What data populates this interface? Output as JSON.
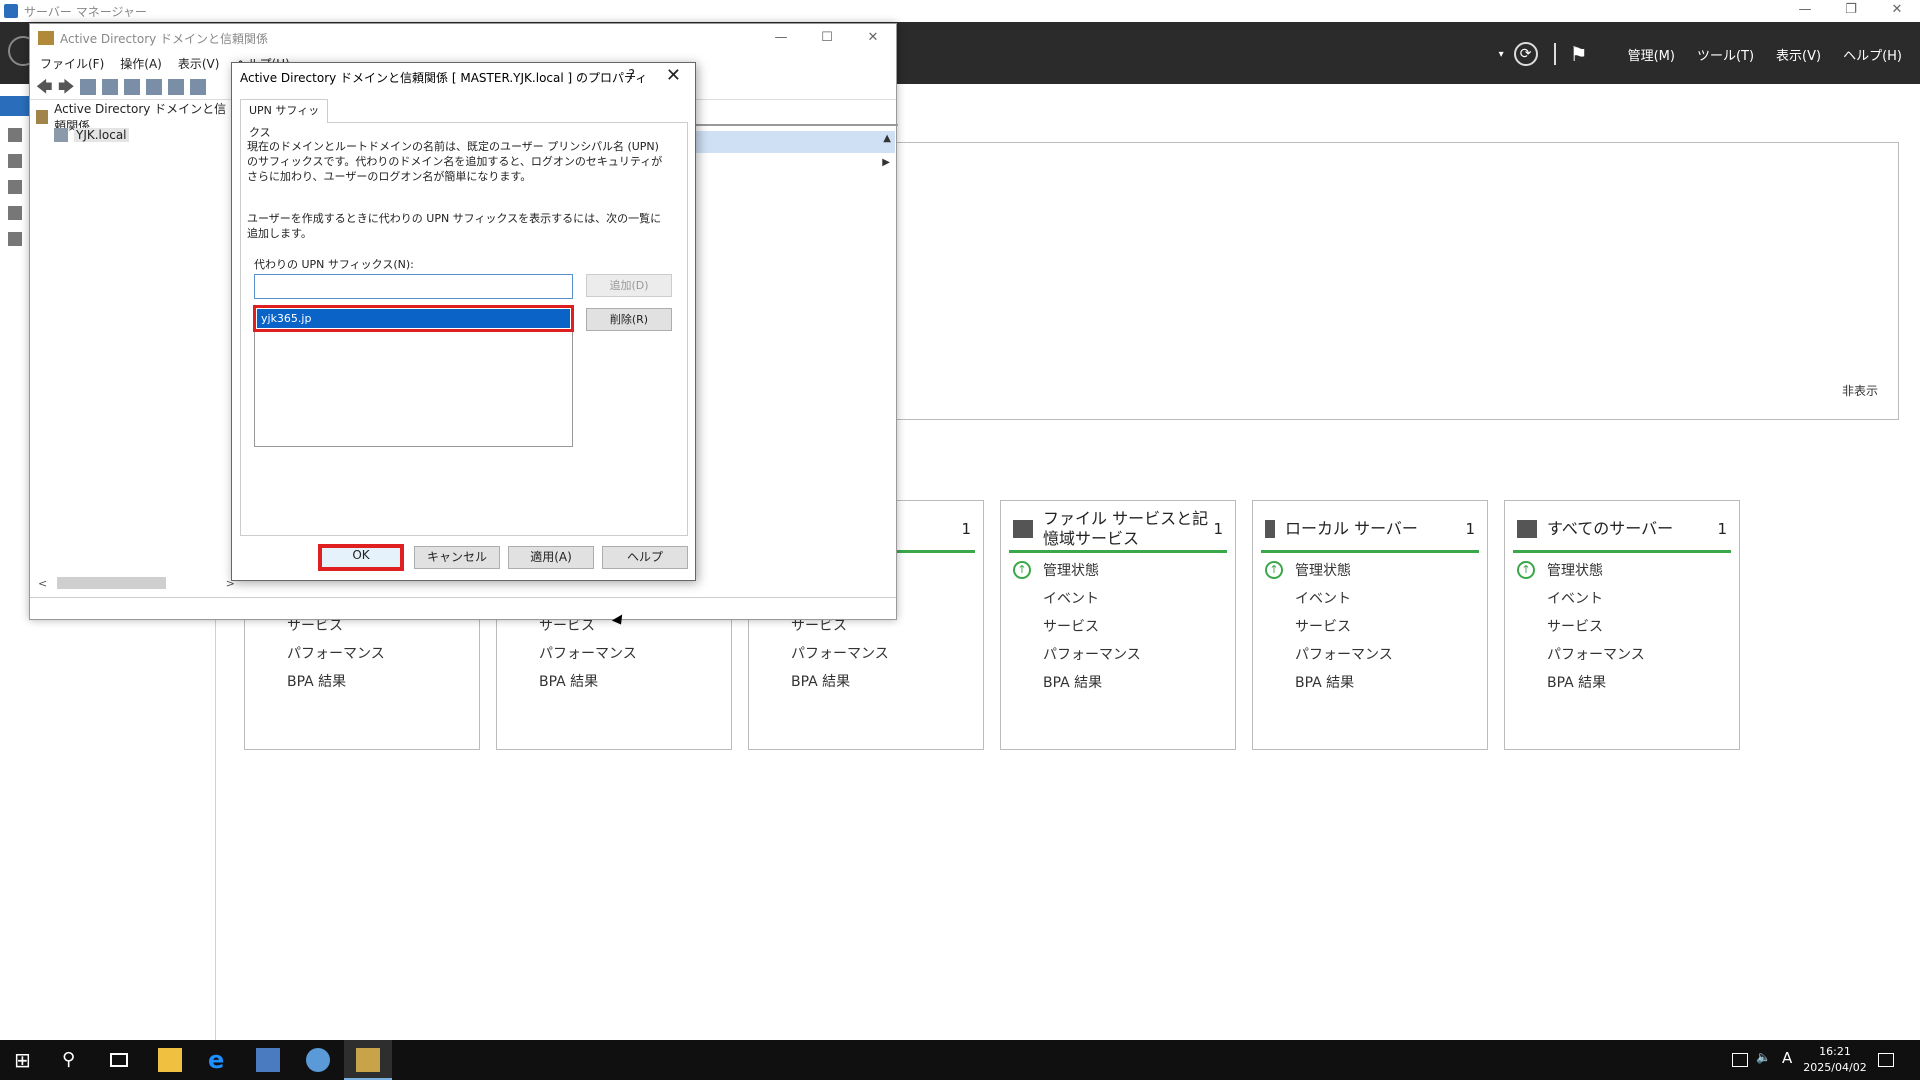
{
  "server_manager": {
    "title": "サーバー マネージャー",
    "win_min": "—",
    "win_restore": "❐",
    "win_close": "✕",
    "menu": {
      "dropdown": "▾",
      "refresh_glyph": "⟳",
      "flag_glyph": "⚑",
      "manage": "管理(M)",
      "tools": "ツール(T)",
      "view": "表示(V)",
      "help": "ヘルプ(H)"
    },
    "welcome": {
      "hide_link": "非表示"
    },
    "tiles": [
      {
        "title": "",
        "count": "",
        "rows": [
          "サービス",
          "パフォーマンス",
          "BPA 結果"
        ]
      },
      {
        "title": "",
        "count": "",
        "rows": [
          "サービス",
          "パフォーマンス",
          "BPA 結果"
        ]
      },
      {
        "title": "",
        "count": "1",
        "rows": [
          "サービス",
          "パフォーマンス",
          "BPA 結果"
        ]
      },
      {
        "title": "ファイル サービスと記憶域サービス",
        "count": "1",
        "rows": [
          "管理状態",
          "イベント",
          "サービス",
          "パフォーマンス",
          "BPA 結果"
        ]
      },
      {
        "title": "ローカル サーバー",
        "count": "1",
        "rows": [
          "管理状態",
          "イベント",
          "サービス",
          "パフォーマンス",
          "BPA 結果"
        ]
      },
      {
        "title": "すべてのサーバー",
        "count": "1",
        "rows": [
          "管理状態",
          "イベント",
          "サービス",
          "パフォーマンス",
          "BPA 結果"
        ]
      }
    ]
  },
  "ad_window": {
    "title": "Active Directory ドメインと信頼関係",
    "win_min": "—",
    "win_max": "☐",
    "win_close": "✕",
    "menu": [
      "ファイル(F)",
      "操作(A)",
      "表示(V)",
      "ヘルプ(H)"
    ],
    "toolbar": {
      "back": "🡄",
      "forward": "🡆"
    },
    "tree": {
      "root": "Active Directory ドメインと信頼関係",
      "child": "YJK.local"
    },
    "scroll_left": "<",
    "scroll_right": ">",
    "right_pane": {
      "sort_up": "▲",
      "expand": "▶"
    }
  },
  "dialog": {
    "title": "Active Directory ドメインと信頼関係 [ MASTER.YJK.local ] のプロパティ",
    "help_glyph": "?",
    "close_glyph": "✕",
    "tab": "UPN サフィックス",
    "desc1": "現在のドメインとルートドメインの名前は、既定のユーザー プリンシパル名 (UPN) のサフィックスです。代わりのドメイン名を追加すると、ログオンのセキュリティがさらに加わり、ユーザーのログオン名が簡単になります。",
    "desc2": "ユーザーを作成するときに代わりの UPN サフィックスを表示するには、次の一覧に追加します。",
    "upn_label": "代わりの UPN サフィックス(N):",
    "upn_input_value": "",
    "upn_list": [
      "yjk365.jp"
    ],
    "add_button": "追加(D)",
    "remove_button": "削除(R)",
    "ok_button": "OK",
    "cancel_button": "キャンセル",
    "apply_button": "適用(A)",
    "help_button": "ヘルプ"
  },
  "taskbar": {
    "start_glyph": "⊞",
    "search_glyph": "⚲",
    "ie_glyph": "e",
    "sound_glyph": "🔈",
    "ime": "A",
    "time": "16:21",
    "date": "2025/04/02"
  },
  "colors": {
    "selection": "#0a64c8",
    "highlight_box": "#e02020",
    "status_green": "#3aa84a",
    "toolbar_dark": "#2b2b2b"
  }
}
